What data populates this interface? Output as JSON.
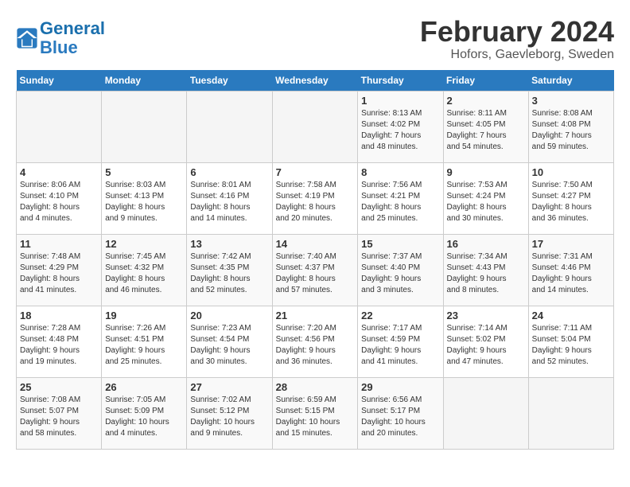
{
  "header": {
    "logo_line1": "General",
    "logo_line2": "Blue",
    "title": "February 2024",
    "subtitle": "Hofors, Gaevleborg, Sweden"
  },
  "weekdays": [
    "Sunday",
    "Monday",
    "Tuesday",
    "Wednesday",
    "Thursday",
    "Friday",
    "Saturday"
  ],
  "weeks": [
    [
      {
        "day": "",
        "info": ""
      },
      {
        "day": "",
        "info": ""
      },
      {
        "day": "",
        "info": ""
      },
      {
        "day": "",
        "info": ""
      },
      {
        "day": "1",
        "info": "Sunrise: 8:13 AM\nSunset: 4:02 PM\nDaylight: 7 hours\nand 48 minutes."
      },
      {
        "day": "2",
        "info": "Sunrise: 8:11 AM\nSunset: 4:05 PM\nDaylight: 7 hours\nand 54 minutes."
      },
      {
        "day": "3",
        "info": "Sunrise: 8:08 AM\nSunset: 4:08 PM\nDaylight: 7 hours\nand 59 minutes."
      }
    ],
    [
      {
        "day": "4",
        "info": "Sunrise: 8:06 AM\nSunset: 4:10 PM\nDaylight: 8 hours\nand 4 minutes."
      },
      {
        "day": "5",
        "info": "Sunrise: 8:03 AM\nSunset: 4:13 PM\nDaylight: 8 hours\nand 9 minutes."
      },
      {
        "day": "6",
        "info": "Sunrise: 8:01 AM\nSunset: 4:16 PM\nDaylight: 8 hours\nand 14 minutes."
      },
      {
        "day": "7",
        "info": "Sunrise: 7:58 AM\nSunset: 4:19 PM\nDaylight: 8 hours\nand 20 minutes."
      },
      {
        "day": "8",
        "info": "Sunrise: 7:56 AM\nSunset: 4:21 PM\nDaylight: 8 hours\nand 25 minutes."
      },
      {
        "day": "9",
        "info": "Sunrise: 7:53 AM\nSunset: 4:24 PM\nDaylight: 8 hours\nand 30 minutes."
      },
      {
        "day": "10",
        "info": "Sunrise: 7:50 AM\nSunset: 4:27 PM\nDaylight: 8 hours\nand 36 minutes."
      }
    ],
    [
      {
        "day": "11",
        "info": "Sunrise: 7:48 AM\nSunset: 4:29 PM\nDaylight: 8 hours\nand 41 minutes."
      },
      {
        "day": "12",
        "info": "Sunrise: 7:45 AM\nSunset: 4:32 PM\nDaylight: 8 hours\nand 46 minutes."
      },
      {
        "day": "13",
        "info": "Sunrise: 7:42 AM\nSunset: 4:35 PM\nDaylight: 8 hours\nand 52 minutes."
      },
      {
        "day": "14",
        "info": "Sunrise: 7:40 AM\nSunset: 4:37 PM\nDaylight: 8 hours\nand 57 minutes."
      },
      {
        "day": "15",
        "info": "Sunrise: 7:37 AM\nSunset: 4:40 PM\nDaylight: 9 hours\nand 3 minutes."
      },
      {
        "day": "16",
        "info": "Sunrise: 7:34 AM\nSunset: 4:43 PM\nDaylight: 9 hours\nand 8 minutes."
      },
      {
        "day": "17",
        "info": "Sunrise: 7:31 AM\nSunset: 4:46 PM\nDaylight: 9 hours\nand 14 minutes."
      }
    ],
    [
      {
        "day": "18",
        "info": "Sunrise: 7:28 AM\nSunset: 4:48 PM\nDaylight: 9 hours\nand 19 minutes."
      },
      {
        "day": "19",
        "info": "Sunrise: 7:26 AM\nSunset: 4:51 PM\nDaylight: 9 hours\nand 25 minutes."
      },
      {
        "day": "20",
        "info": "Sunrise: 7:23 AM\nSunset: 4:54 PM\nDaylight: 9 hours\nand 30 minutes."
      },
      {
        "day": "21",
        "info": "Sunrise: 7:20 AM\nSunset: 4:56 PM\nDaylight: 9 hours\nand 36 minutes."
      },
      {
        "day": "22",
        "info": "Sunrise: 7:17 AM\nSunset: 4:59 PM\nDaylight: 9 hours\nand 41 minutes."
      },
      {
        "day": "23",
        "info": "Sunrise: 7:14 AM\nSunset: 5:02 PM\nDaylight: 9 hours\nand 47 minutes."
      },
      {
        "day": "24",
        "info": "Sunrise: 7:11 AM\nSunset: 5:04 PM\nDaylight: 9 hours\nand 52 minutes."
      }
    ],
    [
      {
        "day": "25",
        "info": "Sunrise: 7:08 AM\nSunset: 5:07 PM\nDaylight: 9 hours\nand 58 minutes."
      },
      {
        "day": "26",
        "info": "Sunrise: 7:05 AM\nSunset: 5:09 PM\nDaylight: 10 hours\nand 4 minutes."
      },
      {
        "day": "27",
        "info": "Sunrise: 7:02 AM\nSunset: 5:12 PM\nDaylight: 10 hours\nand 9 minutes."
      },
      {
        "day": "28",
        "info": "Sunrise: 6:59 AM\nSunset: 5:15 PM\nDaylight: 10 hours\nand 15 minutes."
      },
      {
        "day": "29",
        "info": "Sunrise: 6:56 AM\nSunset: 5:17 PM\nDaylight: 10 hours\nand 20 minutes."
      },
      {
        "day": "",
        "info": ""
      },
      {
        "day": "",
        "info": ""
      }
    ]
  ]
}
